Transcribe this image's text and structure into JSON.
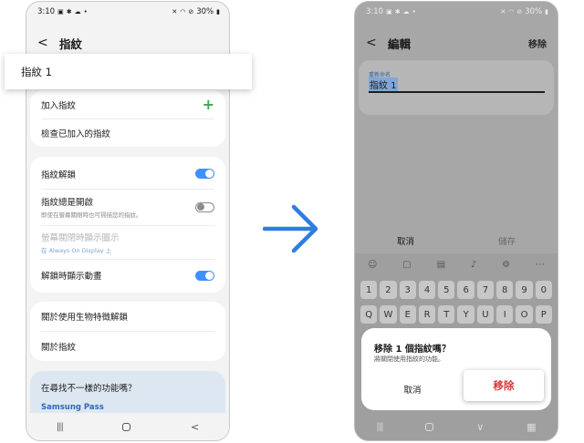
{
  "colors": {
    "accent_blue": "#3e91ff",
    "plus_green": "#3aa757",
    "danger_red": "#d63a3a"
  },
  "left_screen": {
    "status": {
      "time": "3:10",
      "icons": [
        "gallery-icon",
        "gear-icon",
        "cloud-icon",
        "dot-icon"
      ],
      "battery": "30%"
    },
    "header": {
      "title": "指紋"
    },
    "highlight_item": "指紋 1",
    "card1": {
      "add": "加入指紋",
      "check": "檢查已加入的指紋"
    },
    "card2": {
      "unlock": "指紋解鎖",
      "always_on": "指紋總是開啟",
      "always_on_sub": "即使在螢幕關閉時也可掃描您的指紋。",
      "screen_off": "螢幕關閉時顯示圖示",
      "screen_off_sub": "在 Always On Display 上",
      "animation": "解鎖時顯示動畫"
    },
    "toggles": {
      "unlock": true,
      "always_on": false,
      "animation": true
    },
    "card3": {
      "about_bio": "關於使用生物特徵解鎖",
      "about_fp": "關於指紋"
    },
    "card4": {
      "question": "在尋找不一樣的功能嗎？",
      "link": "Samsung Pass"
    }
  },
  "right_screen": {
    "status": {
      "time": "3:10",
      "battery": "30%"
    },
    "header": {
      "title": "編輯",
      "action": "移除"
    },
    "field": {
      "caption": "重新命名",
      "value": "指紋 1"
    },
    "actions": {
      "cancel": "取消",
      "save": "儲存"
    },
    "keyboard": {
      "row1": [
        "1",
        "2",
        "3",
        "4",
        "5",
        "6",
        "7",
        "8",
        "9",
        "0"
      ],
      "row2": [
        "Q",
        "W",
        "E",
        "R",
        "T",
        "Y",
        "U",
        "I",
        "O",
        "P"
      ]
    },
    "dialog": {
      "title": "移除 1 個指紋嗎？",
      "body": "將關閉使用指紋的功能。",
      "cancel": "取消",
      "remove": "移除"
    }
  }
}
